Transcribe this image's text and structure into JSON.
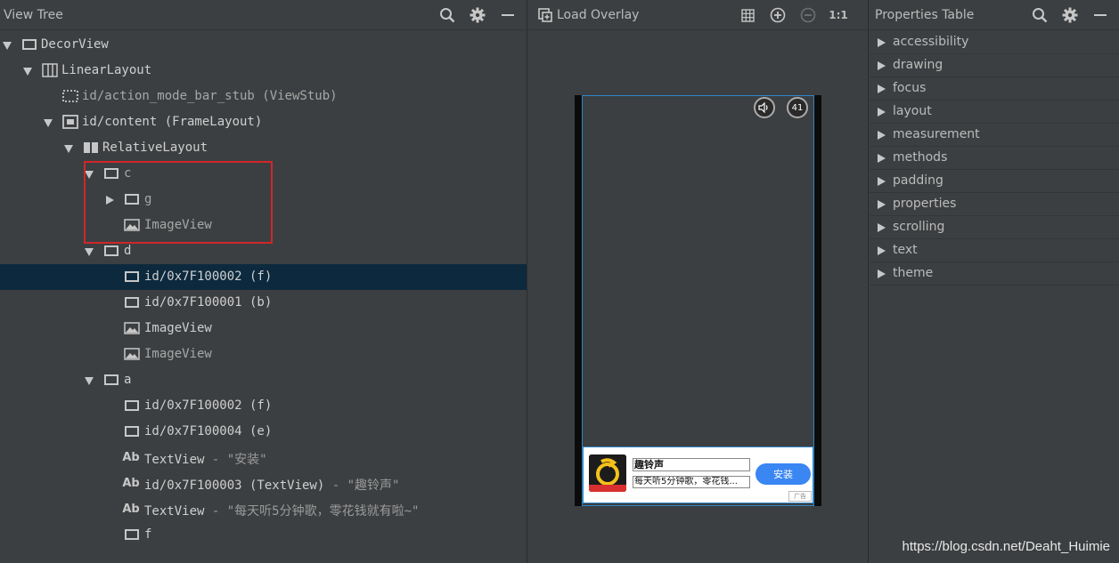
{
  "view_tree": {
    "title": "View Tree",
    "rows": [
      {
        "label": "DecorView",
        "suffix": ""
      },
      {
        "label": "LinearLayout",
        "suffix": ""
      },
      {
        "label": "id/action_mode_bar_stub (ViewStub)",
        "suffix": ""
      },
      {
        "label": "id/content (FrameLayout)",
        "suffix": ""
      },
      {
        "label": "RelativeLayout",
        "suffix": ""
      },
      {
        "label": "c",
        "suffix": ""
      },
      {
        "label": "g",
        "suffix": ""
      },
      {
        "label": "ImageView",
        "suffix": ""
      },
      {
        "label": "d",
        "suffix": ""
      },
      {
        "label": "id/0x7F100002 (f)",
        "suffix": ""
      },
      {
        "label": "id/0x7F100001 (b)",
        "suffix": ""
      },
      {
        "label": "ImageView",
        "suffix": ""
      },
      {
        "label": "ImageView",
        "suffix": ""
      },
      {
        "label": "a",
        "suffix": ""
      },
      {
        "label": "id/0x7F100002 (f)",
        "suffix": ""
      },
      {
        "label": "id/0x7F100004 (e)",
        "suffix": ""
      },
      {
        "label": "TextView",
        "suffix": " - \"安装\""
      },
      {
        "label": "id/0x7F100003 (TextView)",
        "suffix": " - \"趣铃声\""
      },
      {
        "label": "TextView",
        "suffix": " - \"每天听5分钟歌，零花钱就有啦~\""
      },
      {
        "label": "f",
        "suffix": ""
      }
    ]
  },
  "overlay": {
    "load_label": "Load Overlay",
    "zoom_label": "1:1"
  },
  "device": {
    "badge": "41",
    "ad_title": "趣铃声",
    "ad_desc": "每天听5分钟歌，零花钱...",
    "ad_button": "安装",
    "ad_tag": "广告"
  },
  "properties": {
    "title": "Properties Table",
    "items": [
      "accessibility",
      "drawing",
      "focus",
      "layout",
      "measurement",
      "methods",
      "padding",
      "properties",
      "scrolling",
      "text",
      "theme"
    ]
  },
  "watermark": "https://blog.csdn.net/Deaht_Huimie",
  "colors": {
    "panel_bg": "#3c3f41",
    "selected_row": "#0d293e",
    "highlight_box": "#d0262a",
    "screen_border": "#2d86c9",
    "ad_button": "#3a86f2"
  }
}
